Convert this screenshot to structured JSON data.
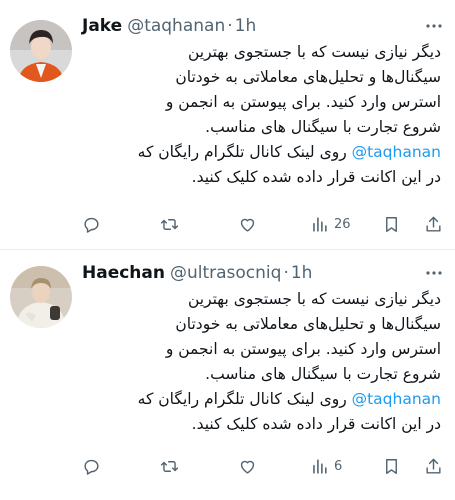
{
  "tweets": [
    {
      "name": "Jake",
      "handle": "@taqhanan",
      "separator": "·",
      "time": "1h",
      "lines_before": [
        "دیگر نیازی نیست که با جستجوی بهترین",
        "سیگنال‌ها و تحلیل‌های معاملاتی به خودتان",
        "استرس وارد کنید.  برای پیوستن به انجمن و",
        "شروع تجارت با سیگنال های مناسب."
      ],
      "mention": "@taqhanan",
      "mention_line_text": " روی لینک کانال تلگرام رایگان که",
      "last_line": "در این اکانت قرار داده شده کلیک کنید.",
      "views": "26",
      "avatar_icon": "avatar-photo-young-man-orange-jacket"
    },
    {
      "name": "Haechan",
      "handle": "@ultrasocniq",
      "separator": "·",
      "time": "1h",
      "lines_before": [
        "دیگر نیازی نیست که با جستجوی بهترین",
        "سیگنال‌ها و تحلیل‌های معاملاتی به خودتان",
        "استرس وارد کنید.  برای پیوستن به انجمن و",
        "شروع تجارت با سیگنال های مناسب."
      ],
      "mention": "@taqhanan",
      "mention_line_text": " روی لینک کانال تلگرام رایگان که",
      "last_line": "در این اکانت قرار داده شده کلیک کنید.",
      "views": "6",
      "avatar_icon": "avatar-photo-man-white-shirt"
    }
  ],
  "colors": {
    "accent": "#1d9bf0",
    "text": "#0f1419",
    "secondary": "#536471",
    "divider": "#e6ecf0"
  },
  "icons": [
    "more-icon",
    "reply-icon",
    "retweet-icon",
    "views-icon",
    "bookmark-icon",
    "share-icon"
  ]
}
